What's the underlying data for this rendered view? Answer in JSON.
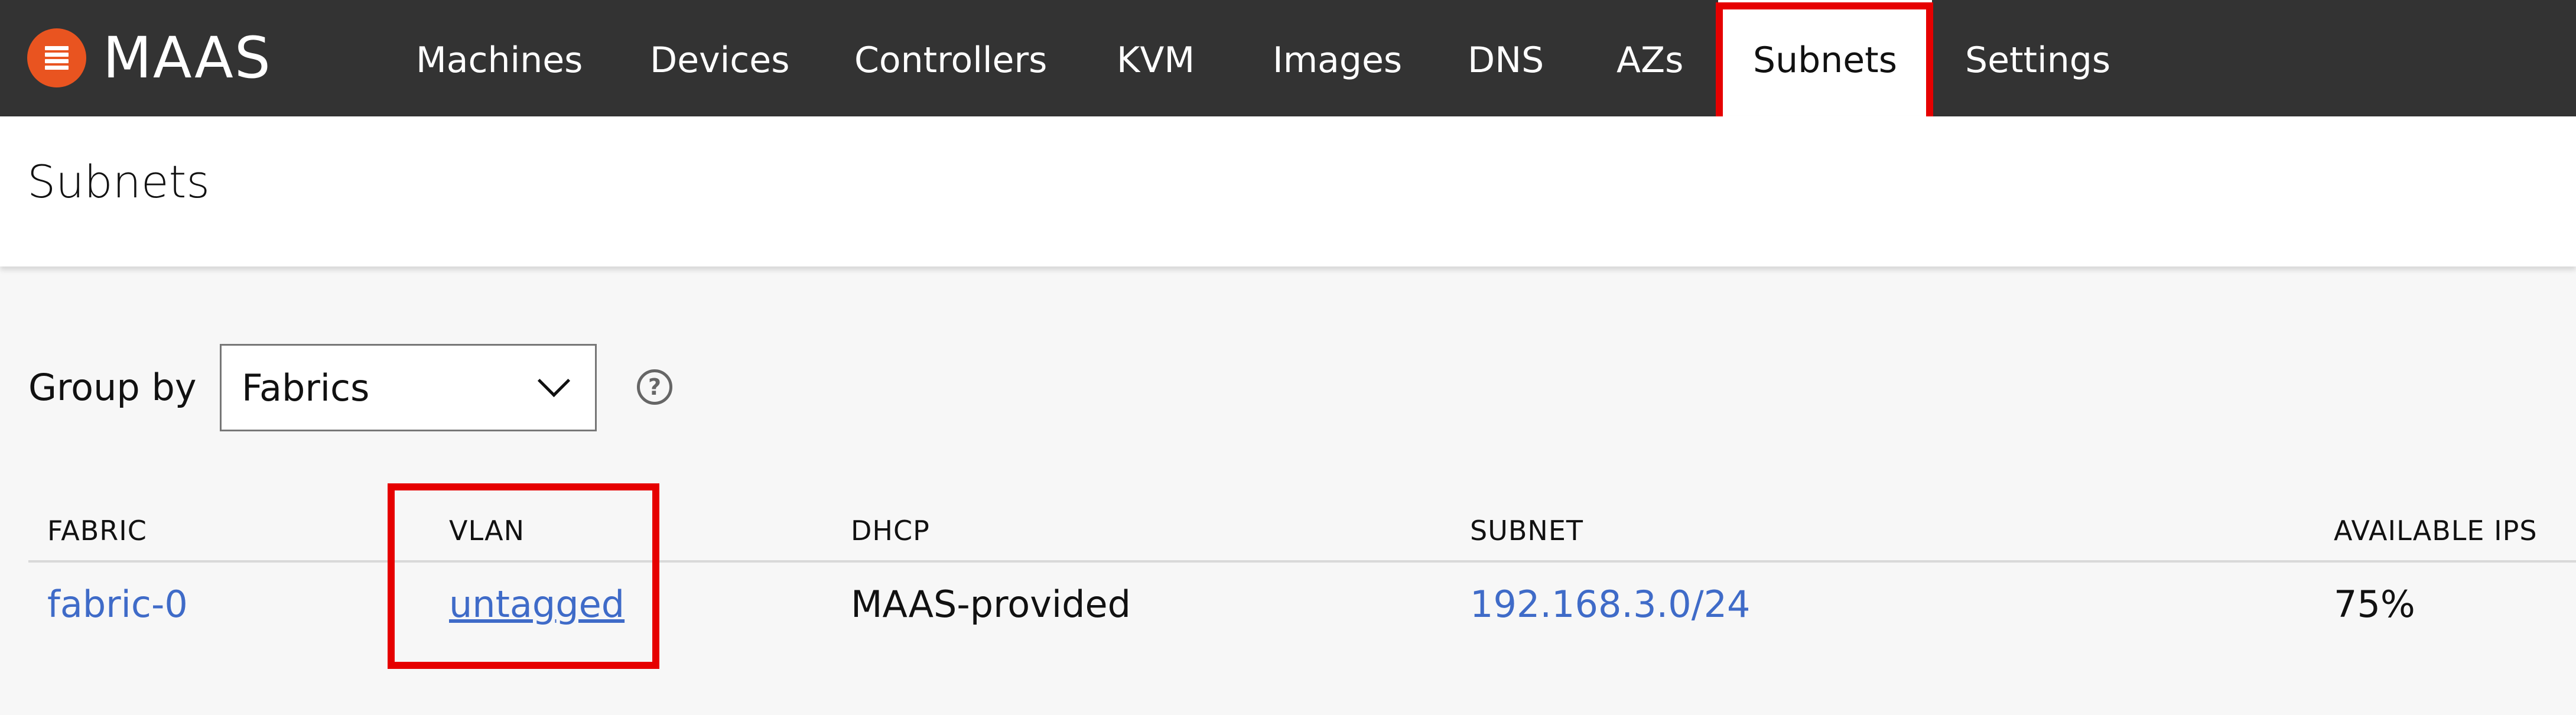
{
  "brand": {
    "name": "MAAS",
    "logo_icon": "maas-logo-icon",
    "accent_color": "#e95420"
  },
  "nav": {
    "items": [
      {
        "label": "Machines"
      },
      {
        "label": "Devices"
      },
      {
        "label": "Controllers"
      },
      {
        "label": "KVM"
      },
      {
        "label": "Images"
      },
      {
        "label": "DNS"
      },
      {
        "label": "AZs"
      },
      {
        "label": "Subnets",
        "active": true
      },
      {
        "label": "Settings"
      }
    ]
  },
  "page": {
    "title": "Subnets"
  },
  "group_by": {
    "label": "Group by",
    "selected": "Fabrics",
    "help_icon": "question-circle-icon",
    "help_glyph": "?"
  },
  "table": {
    "headers": [
      "FABRIC",
      "VLAN",
      "DHCP",
      "SUBNET",
      "AVAILABLE IPS"
    ],
    "rows": [
      {
        "fabric": "fabric-0",
        "vlan": "untagged",
        "dhcp": "MAAS-provided",
        "subnet": "192.168.3.0/24",
        "available_ips": "75%"
      }
    ]
  },
  "colors": {
    "topbar": "#333333",
    "link": "#3f6bc8",
    "annotation_box": "#e60000"
  }
}
